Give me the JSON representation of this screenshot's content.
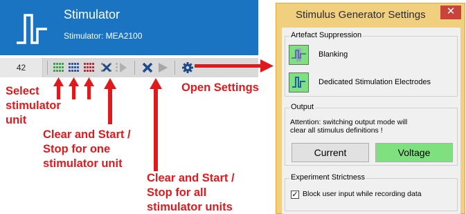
{
  "stimulator": {
    "title": "Stimulator",
    "subtitle": "Stimulator:  MEA2100",
    "number": "42"
  },
  "annotations": {
    "select_unit": [
      "Select",
      "stimulator",
      "unit"
    ],
    "one_unit": [
      "Clear and Start /",
      "Stop for one",
      "stimulator unit"
    ],
    "all_units": [
      "Clear and Start /",
      "Stop for all",
      "stimulator units"
    ],
    "open_settings": "Open Settings"
  },
  "dialog": {
    "title": "Stimulus Generator Settings",
    "close": "✕",
    "artefact": {
      "title": "Artefact Suppression",
      "blanking": "Blanking",
      "dedicated": "Dedicated Stimulation Electrodes"
    },
    "output": {
      "title": "Output",
      "note": [
        "Attention: switching output mode will",
        "clear all stimulus definitions !"
      ],
      "current": "Current",
      "voltage": "Voltage"
    },
    "strictness": {
      "title": "Experiment Strictness",
      "checkbox_mark": "✓",
      "checkbox_label": "Block user input while recording data"
    }
  },
  "colors": {
    "header_blue": "#1a74c2",
    "annotation_red": "#e0191d",
    "dialog_frame": "#f0cf7e",
    "active_green": "#7ee07e"
  },
  "icons": [
    "stimulator-logo-icon",
    "grid-green-icon",
    "grid-blue-icon",
    "grid-red-icon",
    "clear-icon",
    "start-icon",
    "clear-all-icon",
    "start-all-icon",
    "gear-icon",
    "blanking-icon",
    "dedicated-electrodes-icon"
  ]
}
